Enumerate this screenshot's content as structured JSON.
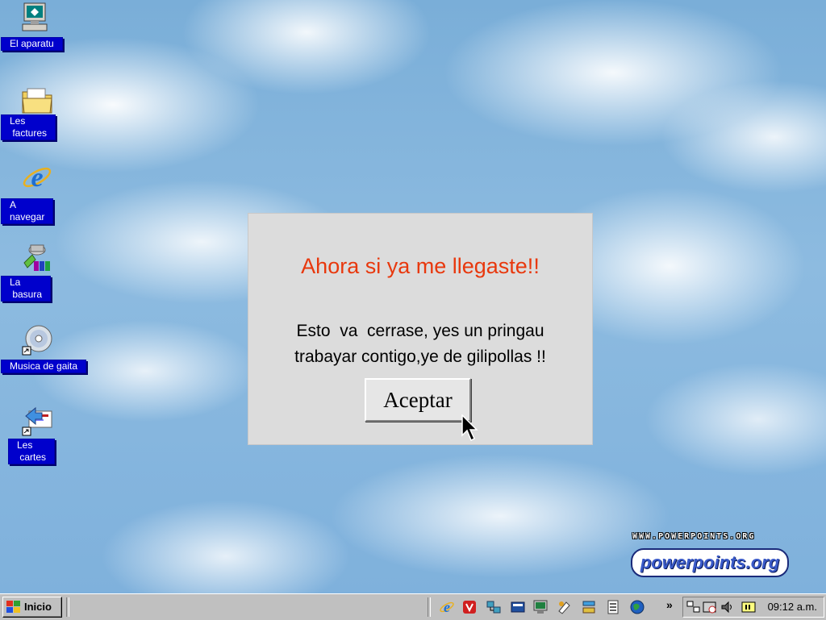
{
  "desktop": {
    "icons": [
      {
        "label": "El aparatu",
        "icon": "my-computer-icon"
      },
      {
        "label": "Les\n factures",
        "icon": "folder-icon"
      },
      {
        "label": "A\nnavegar",
        "icon": "internet-explorer-icon"
      },
      {
        "label": "La\n basura",
        "icon": "recycle-bin-icon"
      },
      {
        "label": "Musica de gaita",
        "icon": "cd-audio-icon"
      },
      {
        "label": "Les\n cartes",
        "icon": "mail-icon"
      }
    ]
  },
  "dialog": {
    "title": "Ahora si ya me llegaste!!",
    "message_line1": "Esto  va  cerrase, yes un pringau",
    "message_line2": "trabayar contigo,ye de gilipollas !!",
    "button_label": "Aceptar"
  },
  "watermark": {
    "url": "WWW.POWERPOINTS.ORG",
    "logo": "powerpoints.org"
  },
  "taskbar": {
    "start_label": "Inicio",
    "quick_launch": [
      "internet-explorer-icon",
      "acrobat-icon",
      "network-icon",
      "outlook-icon",
      "monitor-icon",
      "paint-icon",
      "settings-icon",
      "document-icon",
      "globe-icon"
    ],
    "overflow": "»",
    "tray_icons": [
      "network-tray-icon",
      "scheduler-tray-icon",
      "volume-icon",
      "keyboard-tray-icon"
    ],
    "clock": "09:12 a.m."
  },
  "colors": {
    "title_red": "#e8380d",
    "label_blue": "#0000cc",
    "taskbar_gray": "#c0c0c0",
    "dialog_gray": "#dcdcdc"
  }
}
